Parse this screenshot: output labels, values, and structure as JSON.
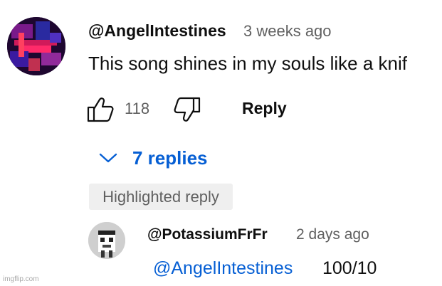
{
  "comment": {
    "author": "@AngelIntestines",
    "time": "3 weeks ago",
    "text": "This song shines in my souls like a knif",
    "like_count": "118",
    "like_icon": "thumbs-up-icon",
    "dislike_icon": "thumbs-down-icon",
    "reply_label": "Reply",
    "replies_label": "7 replies",
    "highlight_badge": "Highlighted reply"
  },
  "reply": {
    "author": "@PotassiumFrFr",
    "time": "2 days ago",
    "mention": "@AngelIntestines",
    "text": "100/10"
  },
  "watermark": "imgflip.com",
  "colors": {
    "link": "#065fd4",
    "secondary_text": "#606060",
    "badge_bg": "#efefef"
  }
}
